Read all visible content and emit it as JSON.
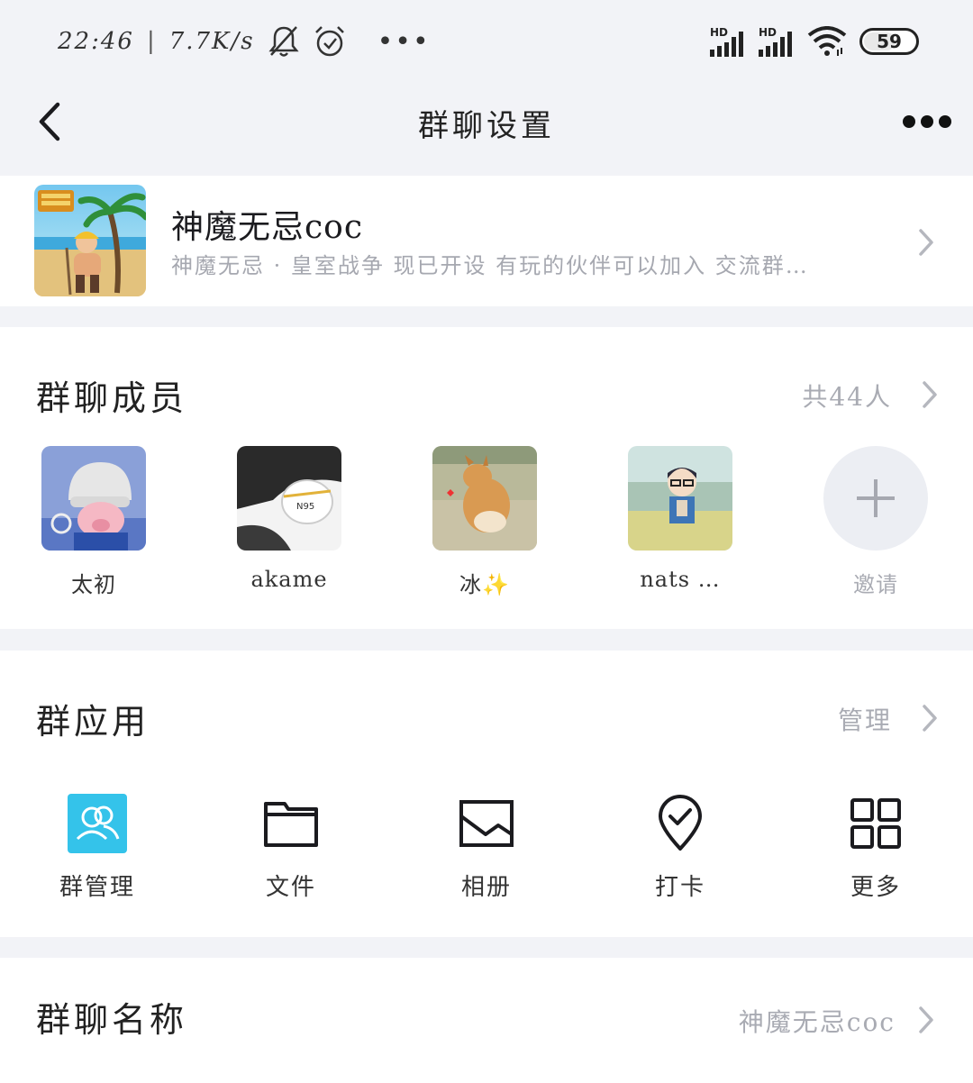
{
  "status_bar": {
    "time": "22:46",
    "network_speed": "7.7K/s",
    "signal1_label": "HD",
    "signal2_label": "HD",
    "battery_level": "59",
    "overflow": "•••",
    "icons": [
      "bell-muted-icon",
      "alarm-clock-icon",
      "signal-icon",
      "signal-icon",
      "wifi-icon",
      "battery-icon"
    ]
  },
  "nav": {
    "title": "群聊设置"
  },
  "group": {
    "name": "神魔无忌coc",
    "description": "神魔无忌 · 皇室战争  现已开设  有玩的伙伴可以加入  交流群…"
  },
  "members": {
    "title": "群聊成员",
    "count_label": "共44人",
    "list": [
      {
        "name": "太初"
      },
      {
        "name": "akame"
      },
      {
        "name": "冰✨"
      },
      {
        "name": "nats  …"
      }
    ],
    "invite_label": "邀请"
  },
  "apps": {
    "title": "群应用",
    "manage_label": "管理",
    "items": [
      {
        "label": "群管理",
        "icon": "group-manage-icon"
      },
      {
        "label": "文件",
        "icon": "folder-icon"
      },
      {
        "label": "相册",
        "icon": "image-icon"
      },
      {
        "label": "打卡",
        "icon": "checkin-pin-icon"
      },
      {
        "label": "更多",
        "icon": "grid-icon"
      }
    ]
  },
  "group_name_row": {
    "title": "群聊名称",
    "value": "神魔无忌coc"
  }
}
